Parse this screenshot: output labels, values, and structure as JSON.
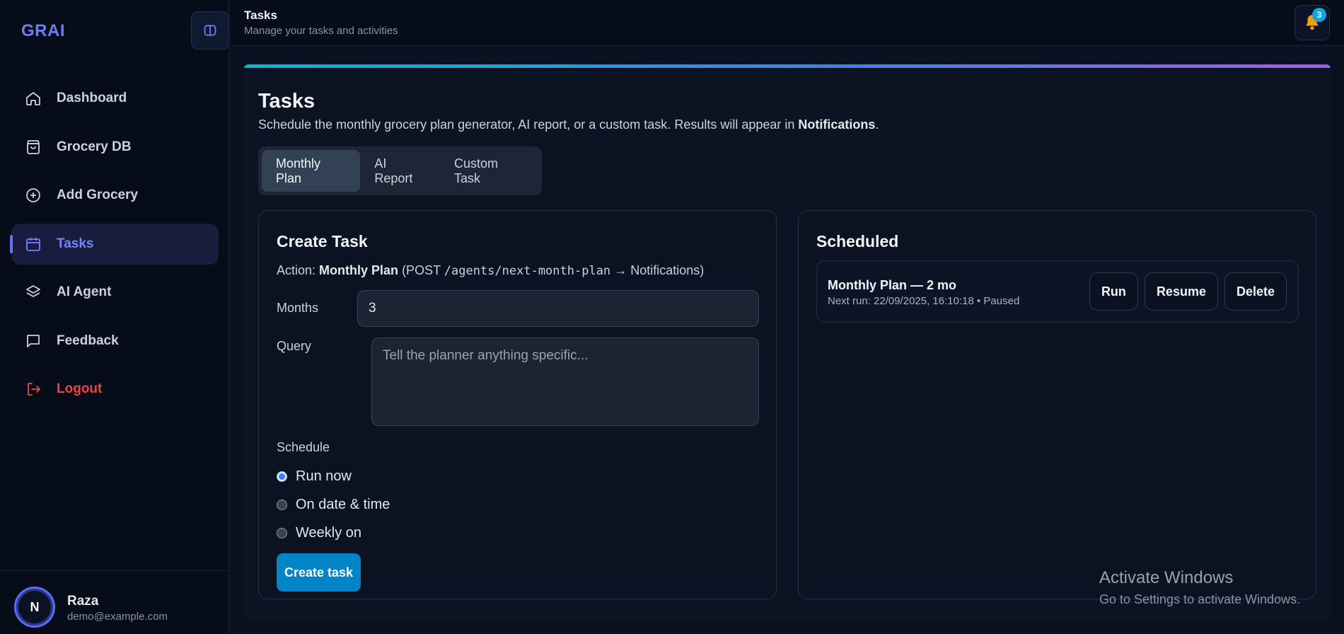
{
  "brand": "GRAI",
  "sidebar": {
    "items": [
      {
        "label": "Dashboard",
        "icon": "home-icon"
      },
      {
        "label": "Grocery DB",
        "icon": "shopping-bag-icon"
      },
      {
        "label": "Add Grocery",
        "icon": "plus-circle-icon"
      },
      {
        "label": "Tasks",
        "icon": "calendar-icon",
        "active": true
      },
      {
        "label": "AI Agent",
        "icon": "layers-icon"
      },
      {
        "label": "Feedback",
        "icon": "message-square-icon"
      },
      {
        "label": "Logout",
        "icon": "logout-icon"
      }
    ]
  },
  "user": {
    "initial": "N",
    "name": "Raza",
    "email": "demo@example.com"
  },
  "header": {
    "title": "Tasks",
    "subtitle": "Manage your tasks and activities",
    "notification_count": "3"
  },
  "page": {
    "title": "Tasks",
    "desc_prefix": "Schedule the monthly grocery plan generator, AI report, or a custom task. Results will appear in ",
    "desc_bold": "Notifications",
    "desc_suffix": "."
  },
  "tabs": [
    {
      "label": "Monthly Plan",
      "active": true
    },
    {
      "label": "AI Report"
    },
    {
      "label": "Custom Task"
    }
  ],
  "create": {
    "title": "Create Task",
    "action_label": "Action:",
    "action_name": "Monthly Plan",
    "action_open": "(POST",
    "action_path": "/agents/next-month-plan",
    "action_close": "→ Notifications)",
    "months_label": "Months",
    "months_value": "3",
    "query_label": "Query",
    "query_placeholder": "Tell the planner anything specific...",
    "schedule_label": "Schedule",
    "schedule_options": [
      {
        "label": "Run now",
        "checked": true
      },
      {
        "label": "On date & time"
      },
      {
        "label": "Weekly on"
      }
    ],
    "submit_label": "Create task"
  },
  "scheduled": {
    "title": "Scheduled",
    "items": [
      {
        "name": "Monthly Plan — 2 mo",
        "meta": "Next run: 22/09/2025, 16:10:18 • Paused",
        "actions": [
          "Run",
          "Resume",
          "Delete"
        ]
      }
    ]
  },
  "watermark": {
    "title": "Activate Windows",
    "subtitle": "Go to Settings to activate Windows."
  },
  "colors": {
    "accent": "#6f86ff",
    "primary_button": "#0284c7",
    "danger": "#ef4444",
    "badge": "#0ea5e9"
  }
}
